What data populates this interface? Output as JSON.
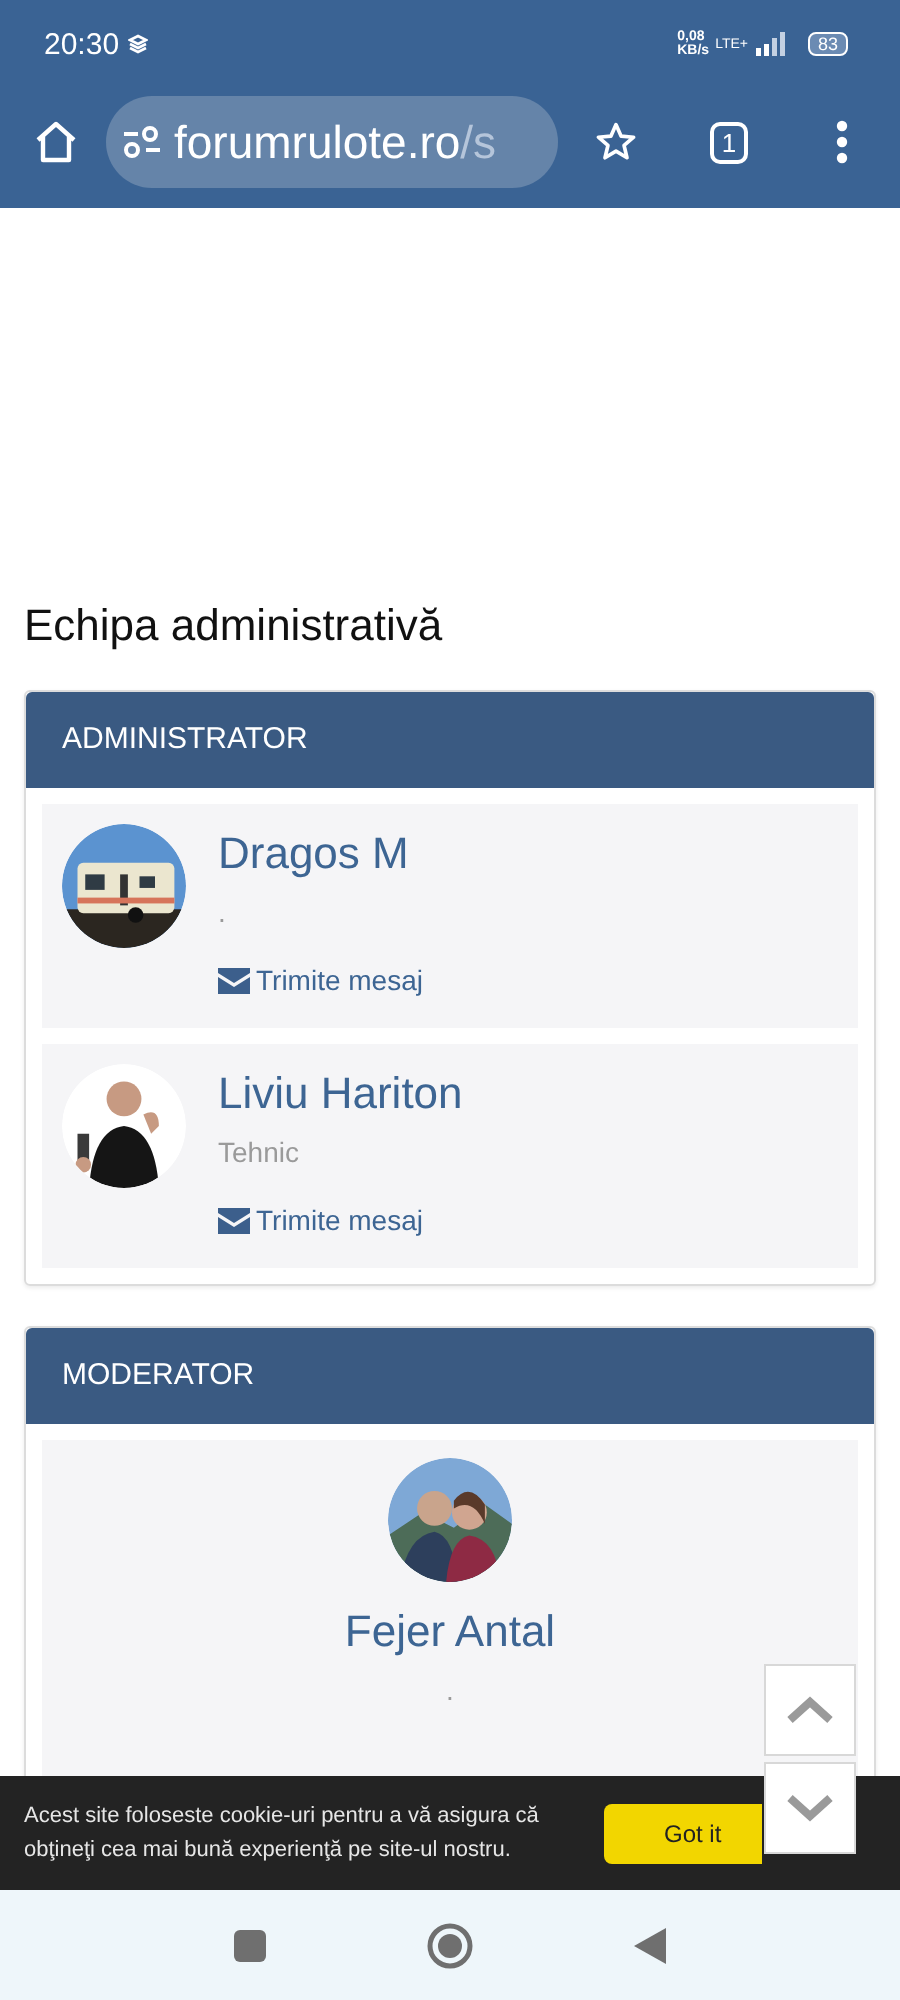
{
  "status_bar": {
    "time": "20:30",
    "speed_value": "0,08",
    "speed_unit": "KB/s",
    "network": "LTE+",
    "battery": "83"
  },
  "browser": {
    "url_host": "forumrulote.ro",
    "url_path": "/s",
    "tab_count": "1"
  },
  "heading": "Echipa administrativă",
  "groups": [
    {
      "title": "ADMINISTRATOR",
      "kind": "row",
      "members": [
        {
          "name": "Dragos M",
          "subtitle": ".",
          "message": "Trimite mesaj"
        },
        {
          "name": "Liviu Hariton",
          "subtitle": "Tehnic",
          "message": "Trimite mesaj"
        }
      ]
    },
    {
      "title": "MODERATOR",
      "kind": "center",
      "members": [
        {
          "name": "Fejer Antal",
          "subtitle": "."
        }
      ]
    }
  ],
  "cookie_bar": {
    "text": "Acest site foloseste cookie-uri pentru a vă asigura că obţineţi cea mai bună experienţă pe site-ul nostru.",
    "button": "Got it"
  }
}
